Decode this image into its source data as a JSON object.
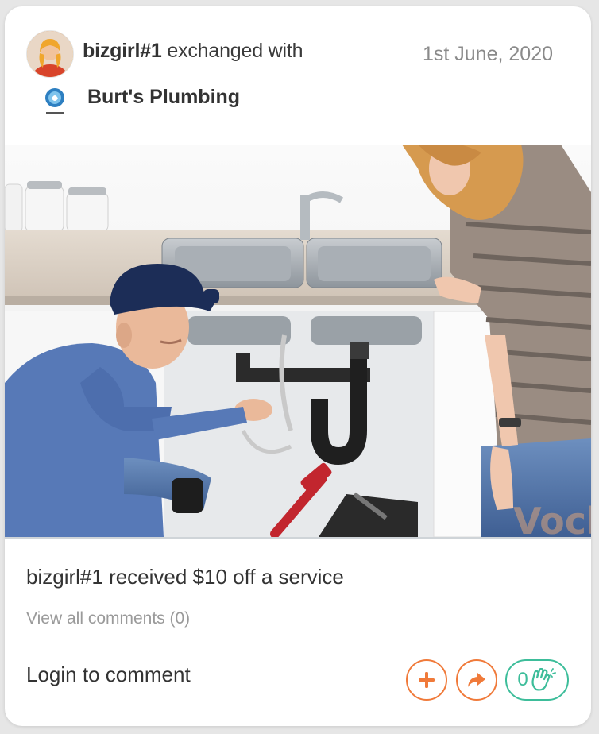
{
  "post": {
    "user": "bizgirl#1",
    "action": "exchanged with",
    "date": "1st June, 2020",
    "business": "Burt's Plumbing",
    "caption": "bizgirl#1 received $10 off a service",
    "view_comments": "View all comments (0)",
    "login_comment": "Login to comment",
    "clap_count": "0",
    "watermark": "Vock"
  },
  "icons": {
    "add": "plus-icon",
    "share": "share-arrow-icon",
    "clap": "clap-hands-icon"
  },
  "colors": {
    "accent_orange": "#f07a3a",
    "accent_green": "#3dbd9a",
    "text_dark": "#333333",
    "text_muted": "#9a9a9a"
  }
}
